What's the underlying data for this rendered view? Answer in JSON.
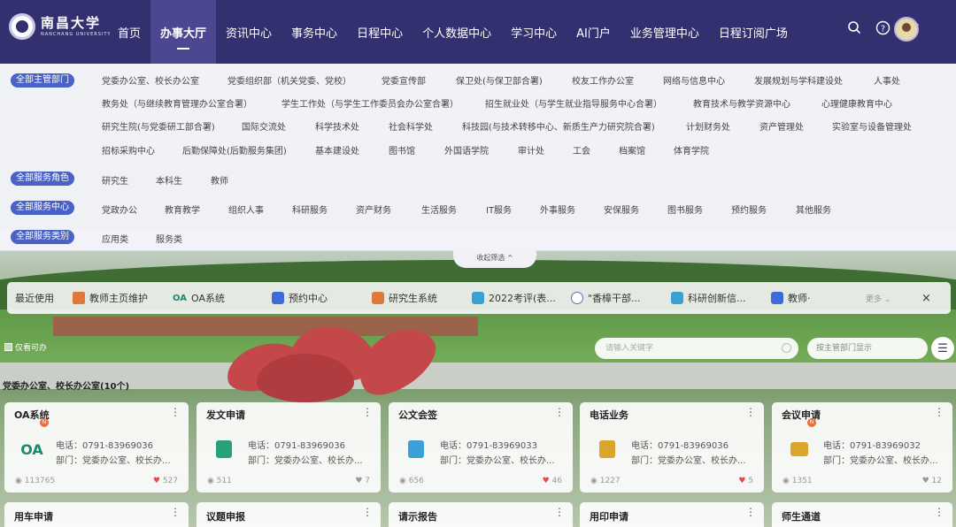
{
  "header": {
    "logo_text": "南昌大学",
    "logo_sub": "NANCHANG UNIVERSITY",
    "nav": [
      "首页",
      "办事大厅",
      "资讯中心",
      "事务中心",
      "日程中心",
      "个人数据中心",
      "学习中心",
      "AI门户",
      "业务管理中心",
      "日程订阅广场"
    ],
    "active_nav": "办事大厅",
    "icons": [
      "search-icon",
      "help-icon",
      "shirt-icon"
    ]
  },
  "filters": {
    "departments_label": "全部主管部门",
    "departments": [
      "党委办公室、校长办公室",
      "党委组织部（机关党委、党校）",
      "党委宣传部",
      "保卫处(与保卫部合署)",
      "校友工作办公室",
      "网络与信息中心",
      "发展规划与学科建设处",
      "人事处",
      "教务处（与继续教育管理办公室合署）",
      "学生工作处（与学生工作委员会办公室合署）",
      "招生就业处（与学生就业指导服务中心合署）",
      "教育技术与教学资源中心",
      "心理健康教育中心",
      "研究生院(与党委研工部合署)",
      "国际交流处",
      "科学技术处",
      "社会科学处",
      "科技园(与技术转移中心、新质生产力研究院合署)",
      "计划财务处",
      "资产管理处",
      "实验室与设备管理处",
      "招标采购中心",
      "后勤保障处(后勤服务集团)",
      "基本建设处",
      "图书馆",
      "外国语学院",
      "审计处",
      "工会",
      "档案馆",
      "体育学院"
    ],
    "roles_label": "全部服务角色",
    "roles": [
      "研究生",
      "本科生",
      "教师"
    ],
    "centers_label": "全部服务中心",
    "centers": [
      "党政办公",
      "教育教学",
      "组织人事",
      "科研服务",
      "资产财务",
      "生活服务",
      "IT服务",
      "外事服务",
      "安保服务",
      "图书服务",
      "预约服务",
      "其他服务"
    ],
    "types_label": "全部服务类别",
    "types": [
      "应用类",
      "服务类"
    ],
    "collapse": "收起筛选 ^"
  },
  "recent": {
    "label": "最近使用",
    "items": [
      {
        "label": "教师主页维护",
        "icon": "house-icon",
        "color": "#e0783a"
      },
      {
        "label": "OA系统",
        "icon": "oa-icon",
        "color": "#1b8a6f"
      },
      {
        "label": "预约中心",
        "icon": "calendar-icon",
        "color": "#3e6bd6"
      },
      {
        "label": "研究生系统",
        "icon": "graduate-icon",
        "color": "#e0783a"
      },
      {
        "label": "2022考评(表...",
        "icon": "form-icon",
        "color": "#3aa0d6"
      },
      {
        "label": "\"香樟干部...",
        "icon": "seal-icon",
        "color": "#6b6bb0"
      },
      {
        "label": "科研创新信...",
        "icon": "research-icon",
        "color": "#3aa0d6"
      },
      {
        "label": "教师·",
        "icon": "teacher-icon",
        "color": "#3e6bd6"
      }
    ],
    "more": "更多 ⌄",
    "close": "×"
  },
  "toolbar": {
    "checkbox_label": "仅看可办",
    "search_placeholder": "请输入关键字",
    "sort_label": "按主管部门显示"
  },
  "section_title": "党委办公室、校长办公室(10个)",
  "cards": [
    {
      "title": "OA系统",
      "phone": "电话：0791-83969036",
      "dept": "部门：党委办公室、校长办...",
      "views": "113765",
      "likes": "527",
      "icon": "oa-icon",
      "color": "#1b8a6f",
      "badge": "N"
    },
    {
      "title": "发文申请",
      "phone": "电话：0791-83969036",
      "dept": "部门：党委办公室、校长办...",
      "views": "511",
      "likes": "7",
      "icon": "document-icon",
      "color": "#2aa07a",
      "badge": ""
    },
    {
      "title": "公文会签",
      "phone": "电话：0791-83969033",
      "dept": "部门：党委办公室、校长办...",
      "views": "656",
      "likes": "46",
      "icon": "clipboard-icon",
      "color": "#3aa0d6",
      "badge": ""
    },
    {
      "title": "电话业务",
      "phone": "电话：0791-83969036",
      "dept": "部门：党委办公室、校长办...",
      "views": "1227",
      "likes": "5",
      "icon": "phone-icon",
      "color": "#d9a52b",
      "badge": ""
    },
    {
      "title": "会议申请",
      "phone": "电话：0791-83969032",
      "dept": "部门：党委办公室、校长办...",
      "views": "1351",
      "likes": "12",
      "icon": "meeting-icon",
      "color": "#d9a52b",
      "badge": "N"
    }
  ],
  "cards_row2": [
    "用车申请",
    "议题申报",
    "请示报告",
    "用印申请",
    "师生通道"
  ]
}
